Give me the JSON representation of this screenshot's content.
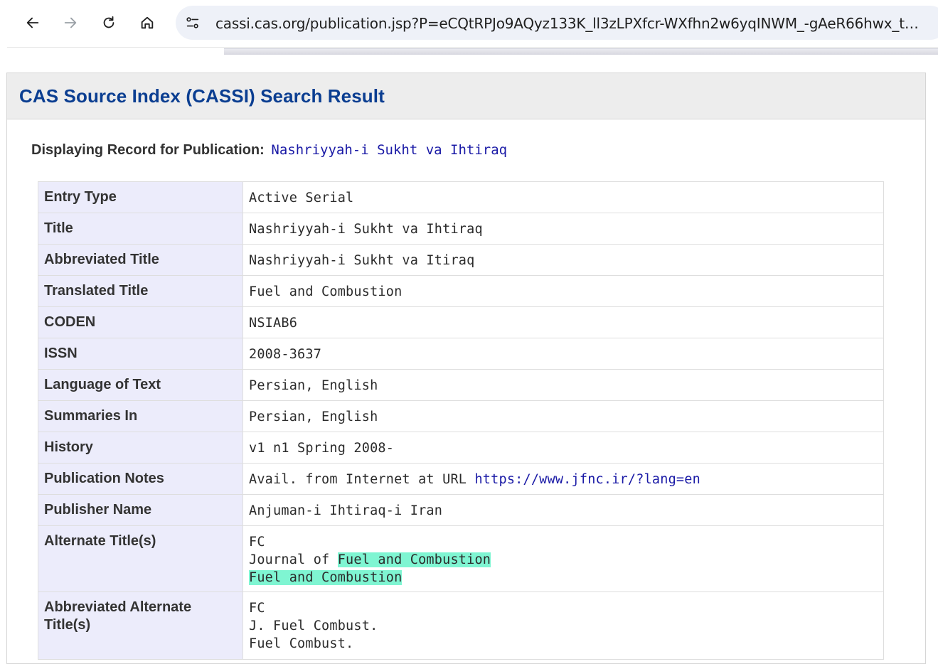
{
  "browser": {
    "url": "cassi.cas.org/publication.jsp?P=eCQtRPJo9AQyz133K_ll3zLPXfcr-WXfhn2w6yqINWM_-gAeR66hwx_thvr-cBt..."
  },
  "page": {
    "title": "CAS Source Index (CASSI) Search Result",
    "record_label": "Displaying Record for Publication:",
    "publication_name": "Nashriyyah-i Sukht va Ihtiraq"
  },
  "record": {
    "entry_type": {
      "label": "Entry Type",
      "value": "Active Serial"
    },
    "title": {
      "label": "Title",
      "value": "Nashriyyah-i Sukht va Ihtiraq"
    },
    "abbreviated_title": {
      "label": "Abbreviated Title",
      "value": "Nashriyyah-i Sukht va Itiraq"
    },
    "translated_title": {
      "label": "Translated Title",
      "value": "Fuel and Combustion"
    },
    "coden": {
      "label": "CODEN",
      "value": "NSIAB6"
    },
    "issn": {
      "label": "ISSN",
      "value": "2008-3637"
    },
    "language": {
      "label": "Language of Text",
      "value": "Persian, English"
    },
    "summaries": {
      "label": "Summaries In",
      "value": "Persian, English"
    },
    "history": {
      "label": "History",
      "value": "v1 n1 Spring 2008-"
    },
    "publication_notes": {
      "label": "Publication Notes",
      "prefix": "Avail. from Internet at URL ",
      "url": "https://www.jfnc.ir/?lang=en"
    },
    "publisher": {
      "label": "Publisher Name",
      "value": "Anjuman-i Ihtiraq-i Iran"
    },
    "alternate_titles": {
      "label": "Alternate Title(s)",
      "line1": "FC",
      "line2_prefix": "Journal of ",
      "line2_highlight": "Fuel and Combustion",
      "line3_highlight": "Fuel and Combustion"
    },
    "abbreviated_alternate_titles": {
      "label": "Abbreviated Alternate Title(s)",
      "lines": [
        "FC",
        "J. Fuel Combust.",
        "Fuel Combust."
      ]
    }
  },
  "colors": {
    "title_blue": "#0b3e91",
    "link_blue": "#1a1aa6",
    "key_column_bg": "#ececfb",
    "highlight": "#7ff5d2"
  }
}
